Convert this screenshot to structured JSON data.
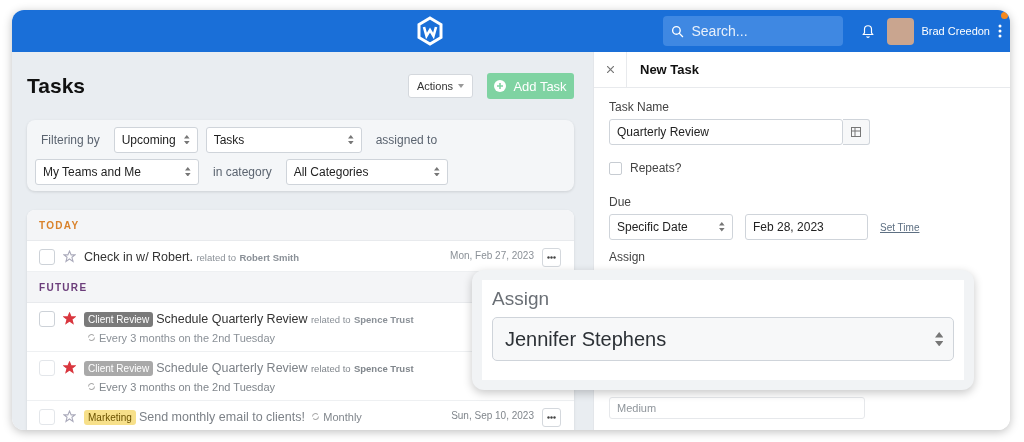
{
  "header": {
    "search": {
      "placeholder": "Search..."
    },
    "user": {
      "name": "Brad Creedon"
    },
    "notification_dot": true
  },
  "tasks_panel": {
    "title": "Tasks",
    "actions_button": "Actions",
    "add_button": "Add Task",
    "filters": {
      "filtering_label": "Filtering by",
      "period": "Upcoming",
      "type": "Tasks",
      "assigned_label": "assigned to",
      "assignee": "My Teams and Me",
      "category_label": "in category",
      "category": "All Categories"
    },
    "sections": [
      {
        "title": "TODAY",
        "color": "#d9822b",
        "tasks": [
          {
            "checked": false,
            "starred": false,
            "title": "Check in w/ Robert.",
            "related_label": "related to",
            "related": "Robert Smith",
            "date": "Mon, Feb 27, 2023"
          }
        ]
      },
      {
        "title": "FUTURE",
        "color": "#6b3d7a",
        "tasks": [
          {
            "checked": false,
            "starred": true,
            "tag": {
              "label": "Client Review",
              "color": "#7a7a7a"
            },
            "title": "Schedule Quarterly Review",
            "related_label": "related to",
            "related": "Spence Trust",
            "repeat": "Every 3 months on the 2nd Tuesday"
          },
          {
            "checked": false,
            "starred": true,
            "tag": {
              "label": "Client Review",
              "color": "#a9a9a9"
            },
            "title": "Schedule Quarterly Review",
            "related_label": "related to",
            "related": "Spence Trust",
            "repeat": "Every 3 months on the 2nd Tuesday"
          },
          {
            "checked": false,
            "starred": false,
            "tag": {
              "label": "Marketing",
              "color": "#f7e08a"
            },
            "title": "Send monthly email to clients!",
            "repeat": "Monthly",
            "date": "Sun, Sep 10, 2023"
          }
        ]
      }
    ]
  },
  "new_task": {
    "title": "New Task",
    "task_name_label": "Task Name",
    "task_name": "Quarterly Review",
    "repeats": {
      "label": "Repeats?",
      "checked": false
    },
    "due_label": "Due",
    "due_type": "Specific Date",
    "due_date": "Feb 28, 2023",
    "set_time": "Set Time",
    "assign_label": "Assign",
    "priority": "Medium"
  },
  "assign_popup": {
    "label": "Assign",
    "value": "Jennifer Stephens"
  }
}
